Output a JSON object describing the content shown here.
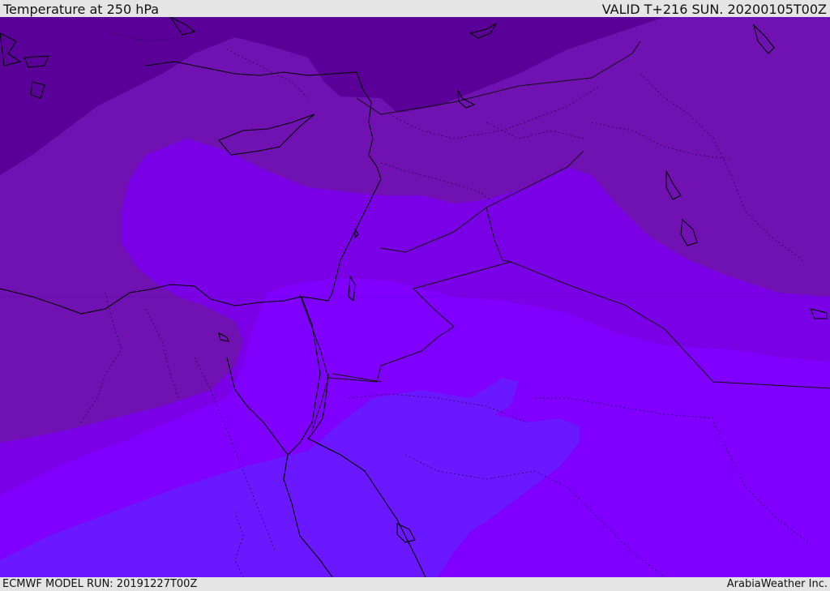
{
  "header": {
    "title": "Temperature at 250 hPa",
    "valid": "VALID T+216 SUN. 20200105T00Z"
  },
  "footer": {
    "model_run": "ECMWF MODEL RUN: 20191227T00Z",
    "credit": "ArabiaWeather Inc."
  },
  "colors": {
    "band_coldest": "#5a0099",
    "band_cold": "#6f12b1",
    "band_mid": "#7a00e6",
    "band_warm": "#7f00ff",
    "band_warmest": "#6a18ff",
    "coastline": "#000000",
    "border": "#1a0033"
  }
}
